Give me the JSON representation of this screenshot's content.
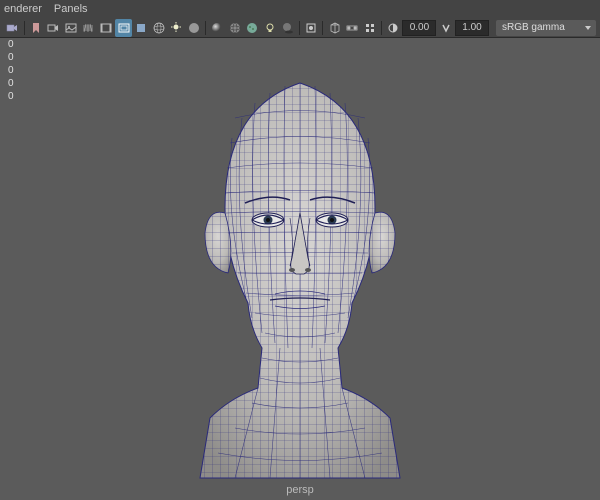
{
  "menu": {
    "renderer": "enderer",
    "panels": "Panels"
  },
  "toolbar": {
    "value1": "0.00",
    "value2": "1.00",
    "color_profile": "sRGB gamma"
  },
  "viewport": {
    "stats": [
      "0",
      "0",
      "0",
      "0",
      "0"
    ],
    "camera": "persp"
  }
}
